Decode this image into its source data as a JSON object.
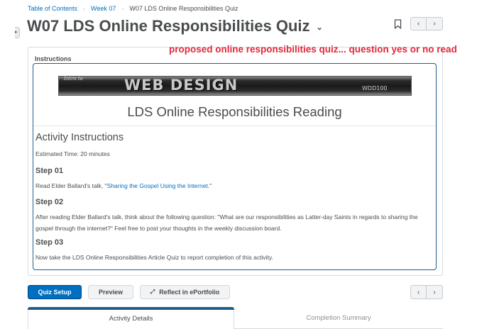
{
  "breadcrumb": {
    "items": [
      "Table of Contents",
      "Week 07"
    ],
    "current": "W07 LDS Online Responsibilities Quiz"
  },
  "page": {
    "title": "W07 LDS Online Responsibilities Quiz"
  },
  "annotation": "proposed online responsibilities quiz... question yes or no read",
  "instructions": {
    "label": "Instructions",
    "banner": {
      "intro_text": "Intro to",
      "title_text": "WEB DESIGN",
      "code_text": "WDD100"
    },
    "reading_title": "LDS Online Responsibilities Reading",
    "activity_heading": "Activity Instructions",
    "estimated_time": "Estimated Time: 20 minutes",
    "steps": [
      {
        "heading": "Step 01",
        "text_before": "Read Elder Ballard's talk, \"",
        "link": "Sharing the Gospel Using the Internet",
        "text_after": ".\""
      },
      {
        "heading": "Step 02",
        "text": "After reading Elder Ballard's talk, think about the following question: \"What are our responsibilities as Latter-day Saints in regards to sharing the gospel through the internet?\" Feel free to post your thoughts in the weekly discussion board."
      },
      {
        "heading": "Step 03",
        "text": "Now take the LDS Online Responsibilities Article Quiz to report completion of this activity."
      }
    ]
  },
  "toolbar": {
    "quiz_setup_label": "Quiz Setup",
    "preview_label": "Preview",
    "reflect_label": "Reflect in ePortfolio"
  },
  "icons": {
    "prev": "chevron-left-icon",
    "next": "chevron-right-icon",
    "bookmark": "bookmark-icon",
    "title_menu": "chevron-down-icon",
    "reflect": "eportfolio-icon"
  },
  "tabs": [
    {
      "label": "Activity Details",
      "active": true
    },
    {
      "label": "Completion Summary",
      "active": false
    }
  ],
  "colors": {
    "accent": "#006fbf",
    "annotation": "#e2283a",
    "panel_border": "#1f5f8f"
  }
}
